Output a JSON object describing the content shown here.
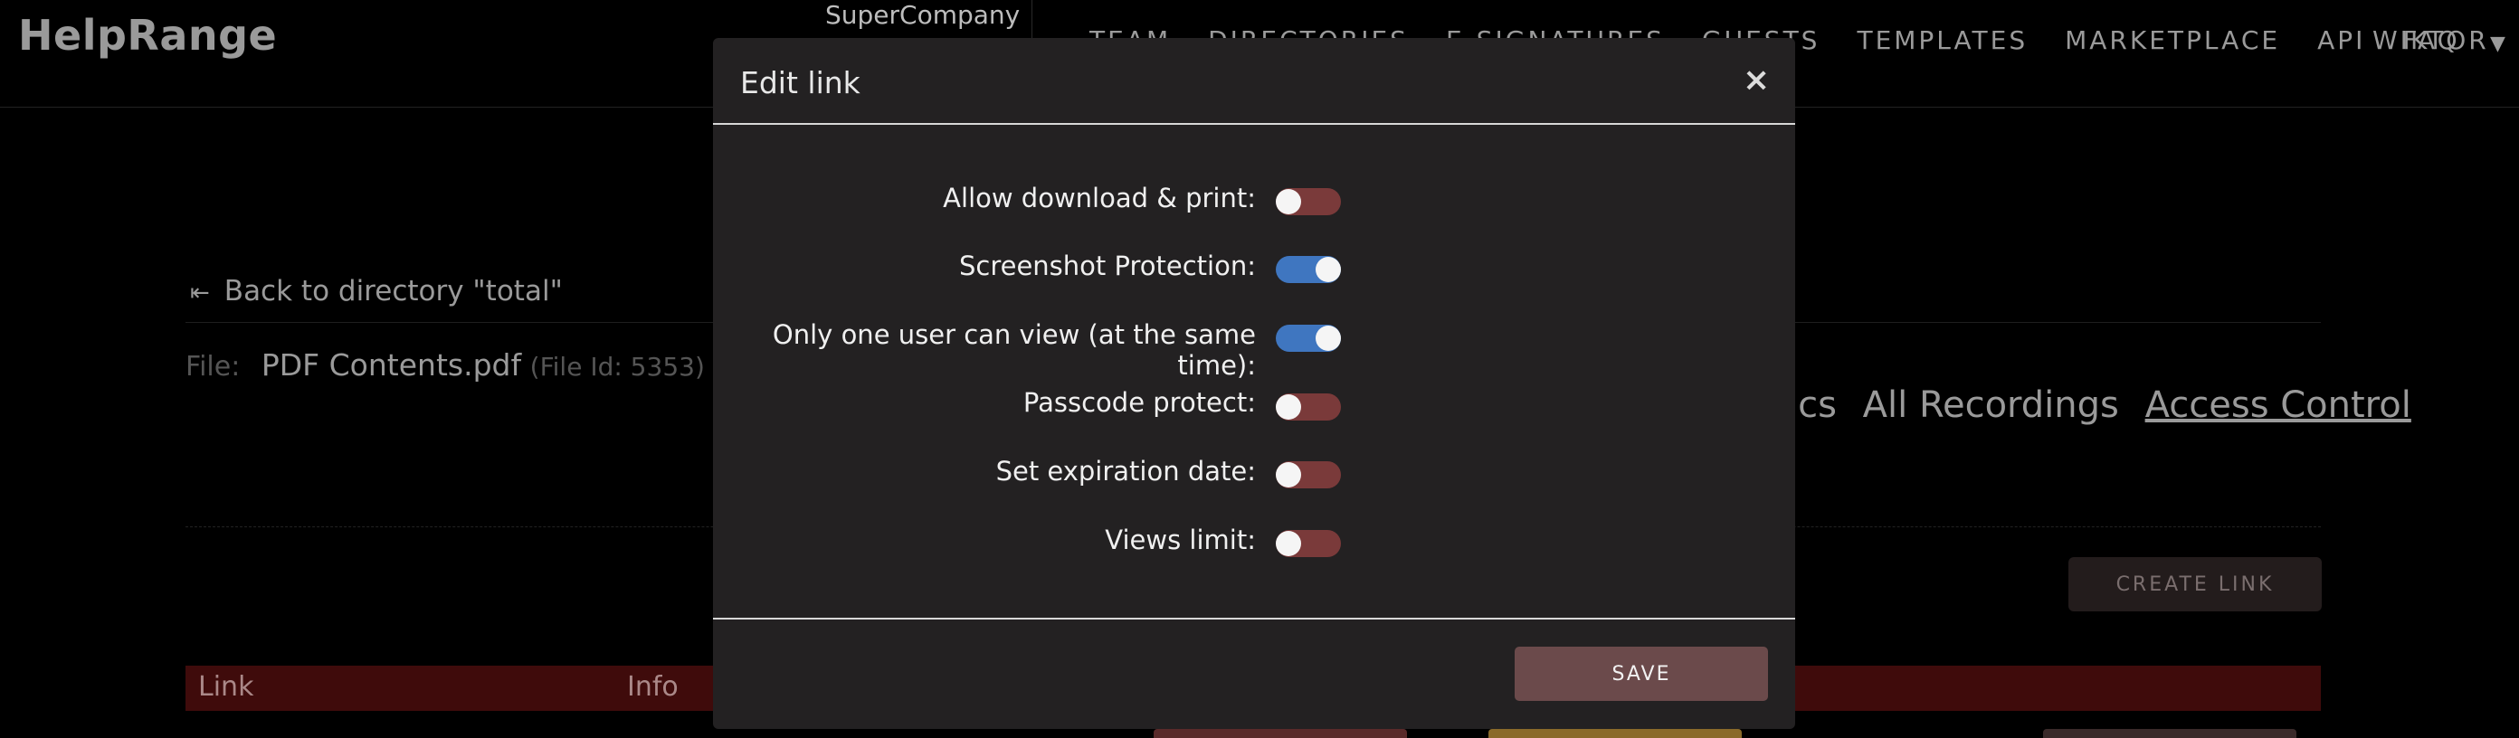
{
  "app": {
    "logo": "HelpRange",
    "company": "SuperCompany"
  },
  "nav": {
    "items": [
      "TEAM",
      "DIRECTORIES",
      "E-SIGNATURES",
      "GUESTS",
      "TEMPLATES",
      "MARKETPLACE",
      "API",
      "FAQ"
    ],
    "user": "WIKTOR"
  },
  "page": {
    "back_link": "Back to directory \"total\"",
    "file_label": "File:",
    "file_name": "PDF Contents.pdf",
    "file_id": "(File Id: 5353)",
    "tabs": [
      "ics",
      "All Recordings",
      "Access Control"
    ],
    "create_link": "CREATE LINK",
    "table_headers": [
      "Link",
      "Info"
    ]
  },
  "modal": {
    "title": "Edit link",
    "close": "×",
    "options": [
      {
        "label": "Allow download & print:",
        "enabled": false
      },
      {
        "label": "Screenshot Protection:",
        "enabled": true
      },
      {
        "label": "Only one user can view (at the same time):",
        "enabled": true
      },
      {
        "label": "Passcode protect:",
        "enabled": false
      },
      {
        "label": "Set expiration date:",
        "enabled": false
      },
      {
        "label": "Views limit:",
        "enabled": false
      }
    ],
    "save": "SAVE"
  },
  "colors": {
    "toggle_on": "#3f76c0",
    "toggle_off": "#7a3a3a",
    "save_button": "#6b4a4b",
    "table_header": "#3f0b0b"
  }
}
